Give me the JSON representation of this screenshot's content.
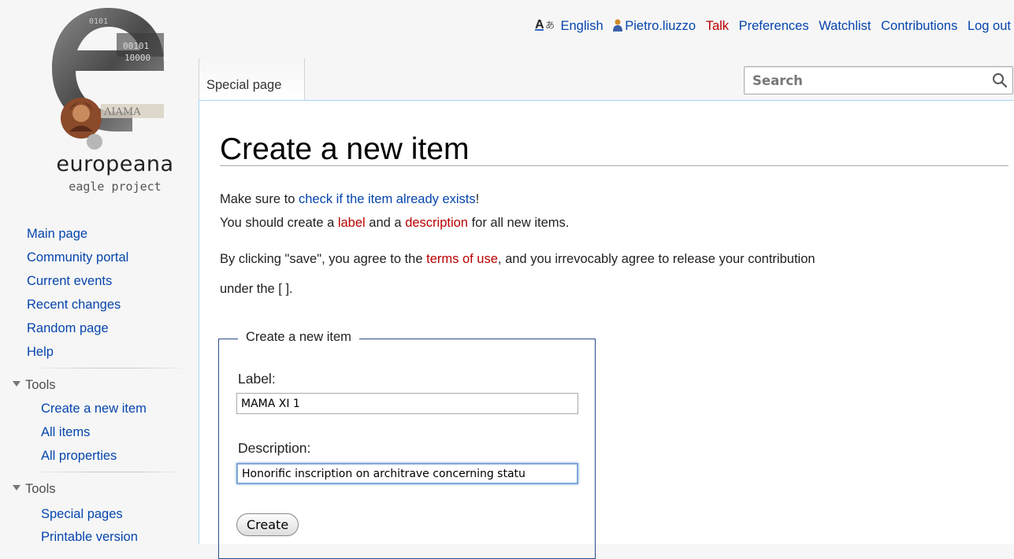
{
  "logo": {
    "word": "europeana",
    "sub": "eagle project"
  },
  "personal": {
    "language": "English",
    "username": "Pietro.liuzzo",
    "talk": "Talk",
    "preferences": "Preferences",
    "watchlist": "Watchlist",
    "contributions": "Contributions",
    "logout": "Log out"
  },
  "tab": {
    "label": "Special page"
  },
  "search": {
    "placeholder": "Search"
  },
  "sidebar": {
    "nav": [
      "Main page",
      "Community portal",
      "Current events",
      "Recent changes",
      "Random page",
      "Help"
    ],
    "tools1": {
      "heading": "Tools",
      "items": [
        "Create a new item",
        "All items",
        "All properties"
      ]
    },
    "tools2": {
      "heading": "Tools",
      "items": [
        "Special pages",
        "Printable version"
      ]
    }
  },
  "content": {
    "title": "Create a new item",
    "line1": {
      "pre": "Make sure to ",
      "link": "check if the item already exists",
      "post": "!"
    },
    "line2": {
      "pre": "You should create a ",
      "label_link": "label",
      "mid": " and a ",
      "desc_link": "description",
      "post": " for all new items."
    },
    "line3": {
      "pre": "By clicking \"save\", you agree to the ",
      "link": "terms of use",
      "post": ", and you irrevocably agree to release your contribution"
    },
    "line4": "under the [ ]."
  },
  "form": {
    "legend": "Create a new item",
    "label_caption": "Label:",
    "label_value": "MAMA XI 1",
    "description_caption": "Description:",
    "description_value": "Honorific inscription on architrave concerning statu",
    "submit": "Create"
  }
}
